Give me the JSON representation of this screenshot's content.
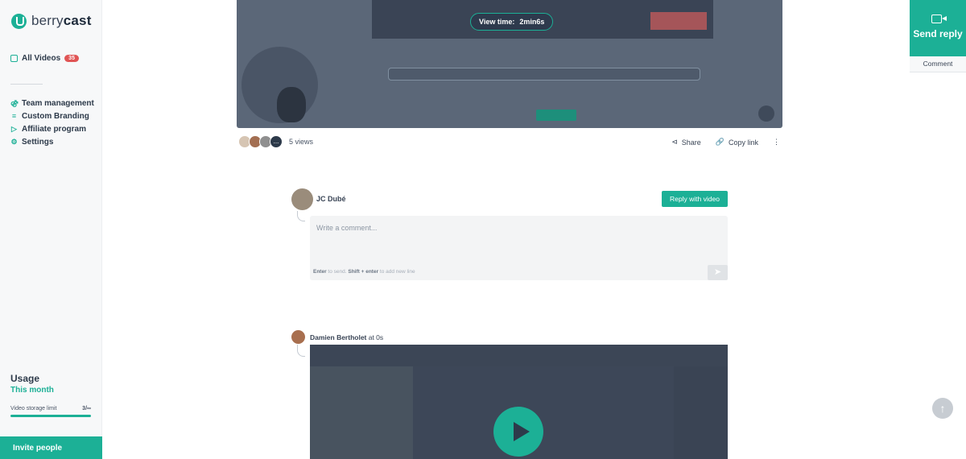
{
  "brand": {
    "name_prefix": "berry",
    "name_suffix": "cast"
  },
  "sidebar": {
    "all_videos": {
      "label": "All Videos",
      "count": "35"
    },
    "items": [
      {
        "label": "Team management",
        "icon": "team-icon"
      },
      {
        "label": "Custom Branding",
        "icon": "sliders-icon"
      },
      {
        "label": "Affiliate program",
        "icon": "megaphone-icon"
      },
      {
        "label": "Settings",
        "icon": "gear-icon"
      }
    ],
    "usage": {
      "title": "Usage",
      "subtitle": "This month",
      "storage_label": "Video storage limit",
      "storage_value": "3/∞",
      "storage_fraction": 1.0
    },
    "invite_label": "Invite people"
  },
  "video": {
    "view_time_label": "View time:",
    "view_time_value": "2min6s"
  },
  "viewers": {
    "more": "...",
    "views_text": "5 views"
  },
  "actions": {
    "share": "Share",
    "copy_link": "Copy link",
    "more": "⋮"
  },
  "comment_form": {
    "author": "JC Dubé",
    "reply_with_video": "Reply with video",
    "placeholder": "Write a comment...",
    "hint_enter": "Enter",
    "hint_to_send": " to send. ",
    "hint_shift": "Shift + enter",
    "hint_newline": " to add new line"
  },
  "comments": [
    {
      "author": "Damien Bertholet",
      "timestamp": " at 0s"
    }
  ],
  "right_panel": {
    "send_reply": "Send reply",
    "comment": "Comment"
  },
  "colors": {
    "accent": "#1cb096",
    "badge": "#e05555",
    "dark": "#2d3a4a"
  }
}
